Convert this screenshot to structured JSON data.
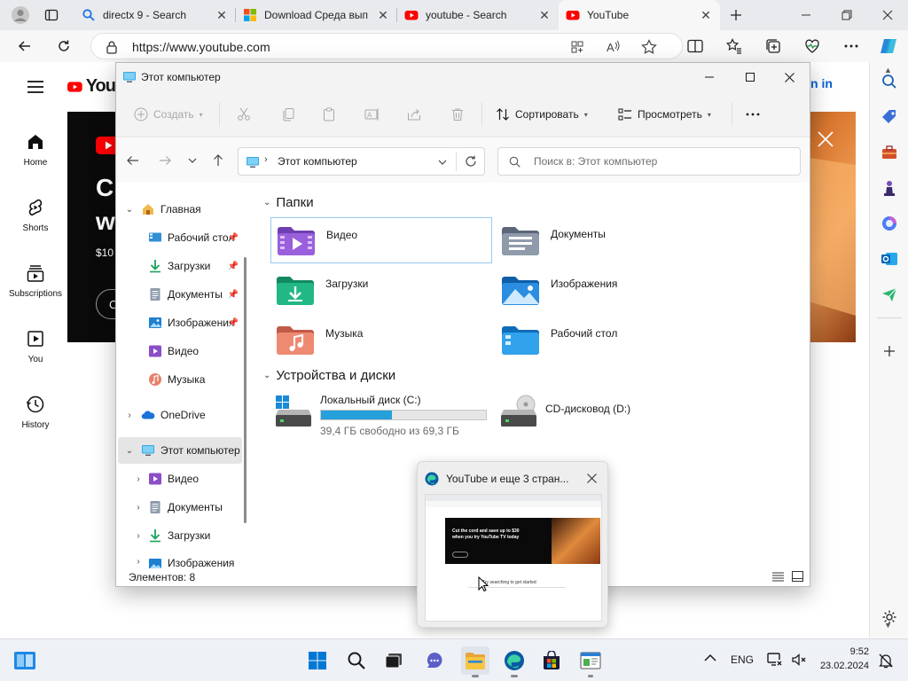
{
  "browser": {
    "tabs": [
      {
        "title": "",
        "icon": "profile-avatar-icon"
      },
      {
        "title": "directx 9 - Search",
        "icon": "search-icon"
      },
      {
        "title": "Download Среда вып",
        "icon": "microsoft-logo-icon"
      },
      {
        "title": "youtube - Search",
        "icon": "youtube-icon"
      },
      {
        "title": "YouTube",
        "icon": "youtube-icon"
      }
    ],
    "url": "https://www.youtube.com"
  },
  "youtube": {
    "logo_partial": "You",
    "signin_partial": "n in",
    "nav": [
      {
        "label": "Home",
        "icon": "home-icon"
      },
      {
        "label": "Shorts",
        "icon": "shorts-icon"
      },
      {
        "label": "Subscriptions",
        "icon": "subscriptions-icon"
      },
      {
        "label": "You",
        "icon": "you-icon"
      },
      {
        "label": "History",
        "icon": "history-icon"
      }
    ],
    "banner": {
      "line1": "Cu",
      "line2": "wi",
      "price": "$10",
      "button": "C"
    }
  },
  "explorer": {
    "title": "Этот компьютер",
    "commands": {
      "new": "Создать",
      "sort": "Сортировать",
      "view": "Просмотреть"
    },
    "address": "Этот компьютер",
    "search_placeholder": "Поиск в: Этот компьютер",
    "tree": [
      {
        "label": "Главная",
        "level": 0,
        "expanded": true
      },
      {
        "label": "Рабочий стол",
        "level": 1,
        "pinned": true
      },
      {
        "label": "Загрузки",
        "level": 1,
        "pinned": true
      },
      {
        "label": "Документы",
        "level": 1,
        "pinned": true
      },
      {
        "label": "Изображения",
        "level": 1,
        "pinned": true
      },
      {
        "label": "Видео",
        "level": 1
      },
      {
        "label": "Музыка",
        "level": 1
      },
      {
        "label": "OneDrive",
        "level": 0,
        "expanded": false
      },
      {
        "label": "Этот компьютер",
        "level": 0,
        "expanded": true,
        "selected": true
      },
      {
        "label": "Видео",
        "level": 1
      },
      {
        "label": "Документы",
        "level": 1
      },
      {
        "label": "Загрузки",
        "level": 1
      },
      {
        "label": "Изображения",
        "level": 1
      }
    ],
    "sections": {
      "folders": "Папки",
      "devices": "Устройства и диски"
    },
    "folders": [
      {
        "label": "Видео",
        "icon": "video-folder-icon"
      },
      {
        "label": "Документы",
        "icon": "documents-folder-icon"
      },
      {
        "label": "Загрузки",
        "icon": "downloads-folder-icon"
      },
      {
        "label": "Изображения",
        "icon": "pictures-folder-icon"
      },
      {
        "label": "Музыка",
        "icon": "music-folder-icon"
      },
      {
        "label": "Рабочий стол",
        "icon": "desktop-folder-icon"
      }
    ],
    "drives": [
      {
        "label": "Локальный диск (C:)",
        "free_text": "39,4 ГБ свободно из 69,3 ГБ",
        "used_fraction": 0.43
      },
      {
        "label": "CD-дисковод (D:)"
      }
    ],
    "status": "Элементов: 8"
  },
  "preview": {
    "title": "YouTube и еще 3 стран...",
    "thumb_heading1": "Cut the cord and save up to $30",
    "thumb_heading2": "when you try YouTube TV today",
    "thumb_search": "Try searching to get started"
  },
  "taskbar": {
    "lang": "ENG",
    "time": "9:52",
    "date": "23.02.2024"
  },
  "colors": {
    "youtube_red": "#ff0000",
    "win_blue": "#0078d4",
    "folder_yellow": "#f8c440",
    "drive_bar": "#26a0da"
  }
}
